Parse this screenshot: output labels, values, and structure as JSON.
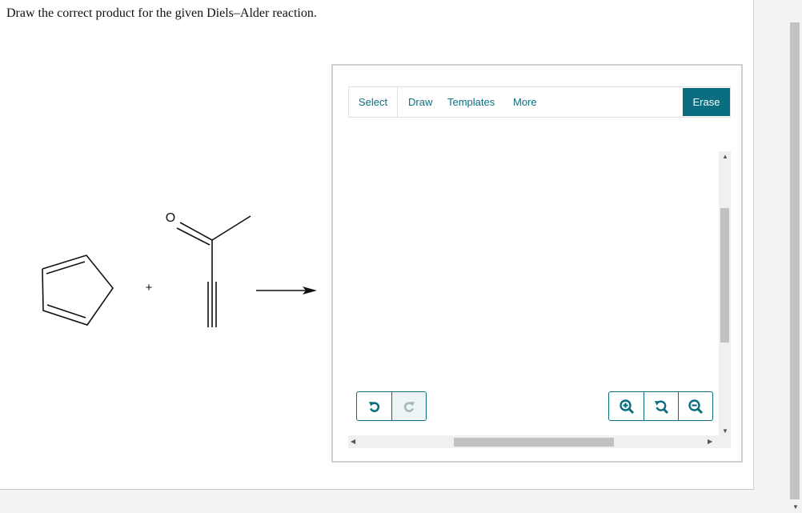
{
  "question": "Draw the correct product for the given Diels–Alder reaction.",
  "reaction": {
    "reactant1_icon": "cyclopentadiene-structure",
    "plus_sign": "+",
    "reactant2_icon": "but-3-yn-2-one-structure",
    "oxygen_label": "O",
    "arrow_icon": "reaction-arrow"
  },
  "editor": {
    "tabs": {
      "select": "Select",
      "draw": "Draw",
      "templates": "Templates",
      "more": "More"
    },
    "erase": "Erase",
    "undo_icon": "undo-icon",
    "redo_icon": "redo-icon",
    "zoom_in_icon": "zoom-in-icon",
    "zoom_reset_icon": "zoom-reset-icon",
    "zoom_out_icon": "zoom-out-icon"
  },
  "colors": {
    "accent": "#0b6e80",
    "scroll_thumb": "#c1c1c1"
  }
}
